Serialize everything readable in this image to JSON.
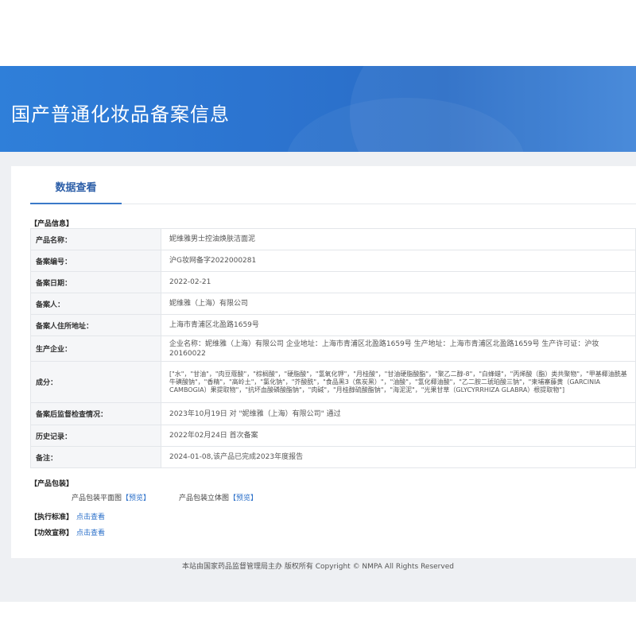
{
  "header": {
    "title": "国产普通化妆品备案信息"
  },
  "tabs": [
    {
      "label": "数据查看"
    }
  ],
  "product_info": {
    "section_label": "【产品信息】",
    "rows": [
      {
        "label": "产品名称：",
        "value": "妮维雅男士控油焕肤洁面泥"
      },
      {
        "label": "备案编号：",
        "value": "沪G妆网备字2022000281"
      },
      {
        "label": "备案日期：",
        "value": "2022-02-21"
      },
      {
        "label": "备案人：",
        "value": "妮维雅（上海）有限公司"
      },
      {
        "label": "备案人住所地址：",
        "value": "上海市青浦区北盈路1659号"
      },
      {
        "label": "生产企业：",
        "value": "企业名称：妮维雅（上海）有限公司 企业地址：上海市青浦区北盈路1659号 生产地址：上海市青浦区北盈路1659号 生产许可证：沪妆 20160022"
      },
      {
        "label": "成分：",
        "value": "[\"水\"，\"甘油\"，\"肉豆蔻酸\"，\"棕榈酸\"，\"硬脂酸\"，\"氢氧化钾\"，\"月桂酸\"，\"甘油硬脂酸酯\"，\"聚乙二醇-8\"，\"白蜂蜡\"，\"丙烯酸（酯）类共聚物\"，\"甲基椰油酰基牛磺酸钠\"，\"香精\"，\"高岭土\"，\"氯化钠\"，\"芥酸酰\"，\"食品黑3（焦炭黑）\"，\"油酸\"，\"氢化椰油酸\"，\"乙二胺二琥珀酸三钠\"，\"柬埔寨藤黄（GARCINIA CAMBOGIA）果提取物\"，\"抗坏血酸磷酸酯钠\"，\"肉碱\"，\"月桂醇硫酸酯钠\"，\"海泥泥\"，\"光果甘草（GLYCYRRHIZA GLABRA）根提取物\"]"
      },
      {
        "label": "备案后监督检查情况：",
        "value": "2023年10月19日 对 \"妮维雅（上海）有限公司\" 通过"
      },
      {
        "label": "历史记录：",
        "value": "2022年02月24日 首次备案"
      },
      {
        "label": "备注：",
        "value": "2024-01-08,该产品已完成2023年度报告"
      }
    ]
  },
  "packaging": {
    "section_label": "【产品包装】",
    "items": [
      {
        "label": "产品包装平面图",
        "link": "【预览】"
      },
      {
        "label": "产品包装立体图",
        "link": "【预览】"
      }
    ]
  },
  "standard": {
    "label": "【执行标准】",
    "link": "点击查看"
  },
  "efficacy": {
    "label": "【功效宣称】",
    "link": "点击查看"
  },
  "footer": {
    "text": "本站由国家药品监督管理局主办 版权所有 Copyright © NMPA All Rights Reserved"
  },
  "colors": {
    "banner": "#2c74d0",
    "link": "#2a6fc9",
    "tab_accent": "#3a79c8"
  }
}
